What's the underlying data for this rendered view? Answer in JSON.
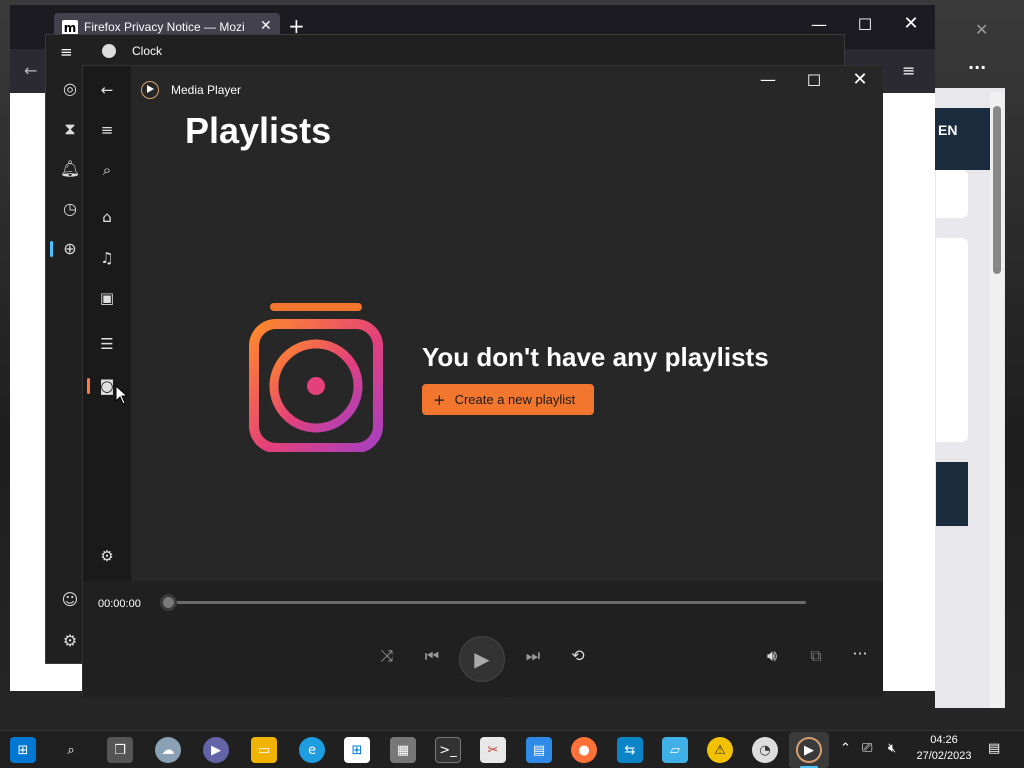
{
  "firefox": {
    "tab_title": "Firefox Privacy Notice — Mozilla",
    "tab_icon_letter": "m",
    "close_tab": "✕",
    "new_tab": "+",
    "right_label": "EN"
  },
  "clock": {
    "title": "Clock",
    "nav": [
      "focus-sessions",
      "timer",
      "alarm",
      "stopwatch",
      "world-clock"
    ],
    "bottom_nav": [
      "account",
      "settings"
    ]
  },
  "media_player": {
    "app_title": "Media Player",
    "page_heading": "Playlists",
    "empty_title": "You don't have any playlists",
    "create_button": "Create a new playlist",
    "create_plus": "+",
    "time": "00:00:00",
    "colors": {
      "accent": "#f2762e",
      "gradient_start": "#ff8a2a",
      "gradient_end": "#a73fc2"
    }
  },
  "taskbar": {
    "time": "04:26",
    "date": "27/02/2023",
    "apps": [
      "start",
      "search",
      "task-view",
      "widgets",
      "teams",
      "file-explorer",
      "edge",
      "store",
      "box-app",
      "terminal",
      "snipping",
      "notepad",
      "firefox",
      "remote-app",
      "files-app",
      "warning-app",
      "clock-app",
      "media-player"
    ]
  }
}
